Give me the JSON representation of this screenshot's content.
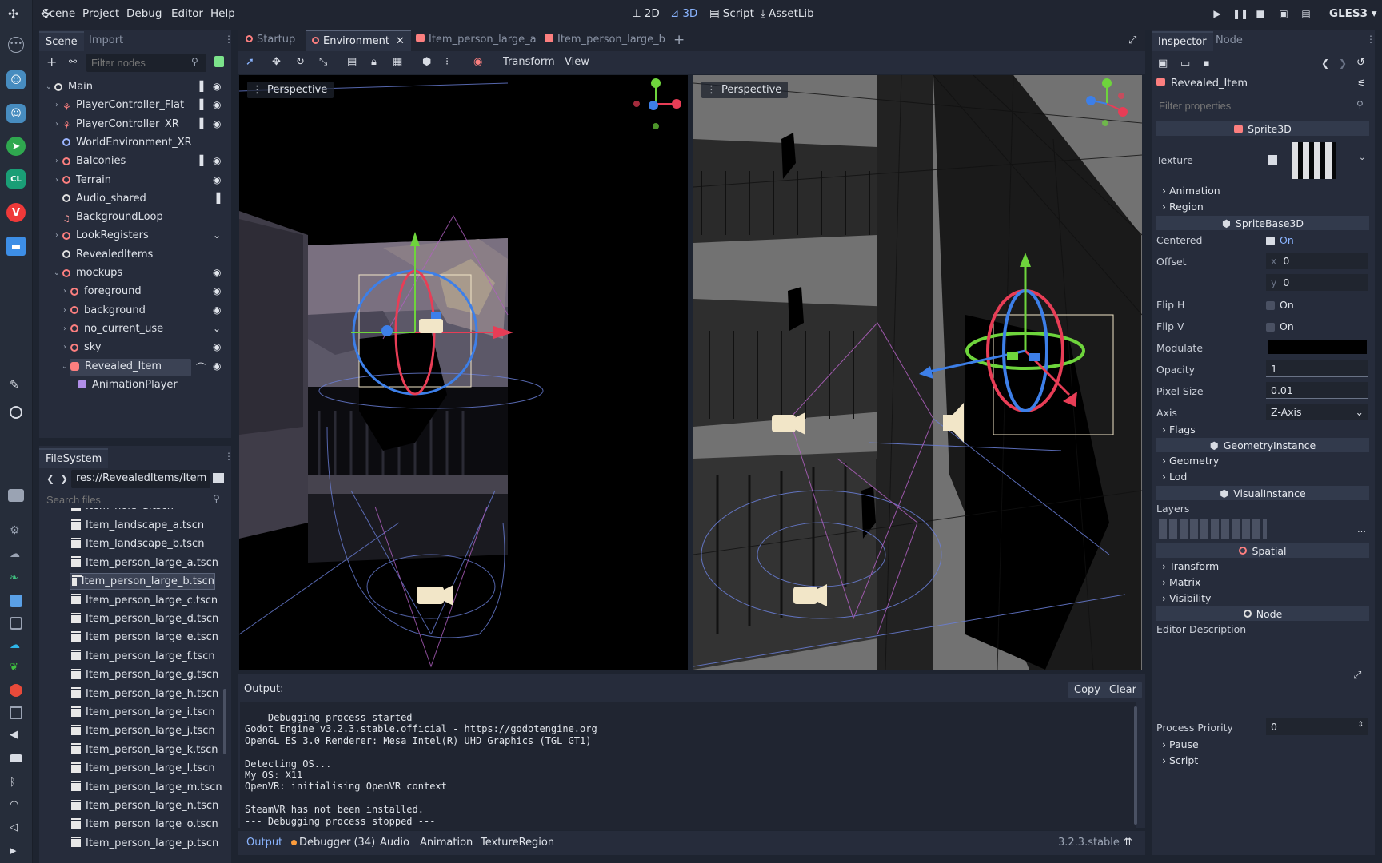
{
  "menu": [
    "Scene",
    "Project",
    "Debug",
    "Editor",
    "Help"
  ],
  "modes": {
    "m2d": "2D",
    "m3d": "3D",
    "script": "Script",
    "assetlib": "AssetLib"
  },
  "renderer": "GLES3",
  "scene_dock": {
    "tabs": [
      "Scene",
      "Import"
    ],
    "filter_placeholder": "Filter nodes",
    "tree": [
      {
        "label": "Main",
        "depth": 0,
        "icon": "node-white"
      },
      {
        "label": "PlayerController_Flat",
        "depth": 1,
        "icon": "player"
      },
      {
        "label": "PlayerController_XR",
        "depth": 1,
        "icon": "player"
      },
      {
        "label": "WorldEnvironment_XR",
        "depth": 1,
        "icon": "globe"
      },
      {
        "label": "Balconies",
        "depth": 1,
        "icon": "node"
      },
      {
        "label": "Terrain",
        "depth": 1,
        "icon": "node"
      },
      {
        "label": "Audio_shared",
        "depth": 1,
        "icon": "node-white"
      },
      {
        "label": "BackgroundLoop",
        "depth": 1,
        "icon": "music"
      },
      {
        "label": "LookRegisters",
        "depth": 1,
        "icon": "node"
      },
      {
        "label": "RevealedItems",
        "depth": 1,
        "icon": "node-white"
      },
      {
        "label": "mockups",
        "depth": 1,
        "icon": "node"
      },
      {
        "label": "foreground",
        "depth": 2,
        "icon": "node"
      },
      {
        "label": "background",
        "depth": 2,
        "icon": "node"
      },
      {
        "label": "no_current_use",
        "depth": 2,
        "icon": "node"
      },
      {
        "label": "sky",
        "depth": 2,
        "icon": "node"
      },
      {
        "label": "Revealed_Item",
        "depth": 2,
        "icon": "sprite"
      },
      {
        "label": "AnimationPlayer",
        "depth": 3,
        "icon": "anim"
      }
    ]
  },
  "filesystem": {
    "title": "FileSystem",
    "path": "res://RevealedItems/Item_",
    "search_placeholder": "Search files",
    "partial_top": "Item_hole_d.tscn",
    "files": [
      "Item_landscape_a.tscn",
      "Item_landscape_b.tscn",
      "Item_person_large_a.tscn",
      "Item_person_large_b.tscn",
      "Item_person_large_c.tscn",
      "Item_person_large_d.tscn",
      "Item_person_large_e.tscn",
      "Item_person_large_f.tscn",
      "Item_person_large_g.tscn",
      "Item_person_large_h.tscn",
      "Item_person_large_i.tscn",
      "Item_person_large_j.tscn",
      "Item_person_large_k.tscn",
      "Item_person_large_l.tscn",
      "Item_person_large_m.tscn",
      "Item_person_large_n.tscn",
      "Item_person_large_o.tscn",
      "Item_person_large_p.tscn"
    ],
    "selected": "Item_person_large_b.tscn"
  },
  "editor_tabs": [
    "Startup",
    "Environment",
    "Item_person_large_a",
    "Item_person_large_b"
  ],
  "viewport_toolbar": {
    "transform": "Transform",
    "view": "View"
  },
  "viewports": {
    "left_label": "Perspective",
    "right_label": "Perspective"
  },
  "output": {
    "title": "Output:",
    "copy": "Copy",
    "clear": "Clear",
    "lines": [
      "--- Debugging process started ---",
      "Godot Engine v3.2.3.stable.official - https://godotengine.org",
      "OpenGL ES 3.0 Renderer: Mesa Intel(R) UHD Graphics (TGL GT1)",
      "",
      "Detecting OS...",
      "My OS: X11",
      "OpenVR: initialising OpenVR context",
      "",
      "SteamVR has not been installed.",
      "--- Debugging process stopped ---"
    ]
  },
  "bottom_tabs": [
    "Output",
    "Debugger (34)",
    "Audio",
    "Animation",
    "TextureRegion"
  ],
  "version": "3.2.3.stable",
  "inspector": {
    "tabs": [
      "Inspector",
      "Node"
    ],
    "object": "Revealed_Item",
    "filter_placeholder": "Filter properties",
    "sprite3d": "Sprite3D",
    "texture": "Texture",
    "animation": "Animation",
    "region": "Region",
    "spritebase3d": "SpriteBase3D",
    "centered": "Centered",
    "on": "On",
    "offset": "Offset",
    "offset_x": "0",
    "offset_y": "0",
    "x": "x",
    "y": "y",
    "flip_h": "Flip H",
    "flip_v": "Flip V",
    "modulate": "Modulate",
    "modulate_color": "#000000",
    "opacity": "Opacity",
    "opacity_val": "1",
    "pixel_size": "Pixel Size",
    "pixel_size_val": "0.01",
    "axis": "Axis",
    "axis_val": "Z-Axis",
    "flags": "Flags",
    "geometry_instance": "GeometryInstance",
    "geometry": "Geometry",
    "lod": "Lod",
    "visual_instance": "VisualInstance",
    "layers": "Layers",
    "spatial": "Spatial",
    "transform": "Transform",
    "matrix": "Matrix",
    "visibility": "Visibility",
    "node": "Node",
    "editor_description": "Editor Description",
    "process_priority": "Process Priority",
    "process_priority_val": "0",
    "pause": "Pause",
    "script": "Script"
  }
}
